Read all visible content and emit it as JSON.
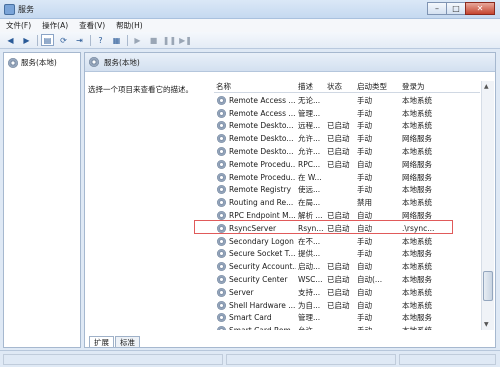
{
  "window": {
    "title": "服务"
  },
  "menu": [
    "文件(F)",
    "操作(A)",
    "查看(V)",
    "帮助(H)"
  ],
  "tree": {
    "root": "服务(本地)"
  },
  "pane": {
    "header": "服务(本地)",
    "description": "选择一个项目来查看它的描述。"
  },
  "columns": {
    "name": "名称",
    "desc": "描述",
    "status": "状态",
    "startup": "启动类型",
    "logon": "登录为"
  },
  "services": [
    {
      "name": "Remote Access ...",
      "desc": "无论...",
      "status": "",
      "startup": "手动",
      "logon": "本地系统"
    },
    {
      "name": "Remote Access ...",
      "desc": "管理...",
      "status": "",
      "startup": "手动",
      "logon": "本地系统"
    },
    {
      "name": "Remote Deskto...",
      "desc": "远程...",
      "status": "已启动",
      "startup": "手动",
      "logon": "本地系统"
    },
    {
      "name": "Remote Deskto...",
      "desc": "允许...",
      "status": "已启动",
      "startup": "手动",
      "logon": "网络服务"
    },
    {
      "name": "Remote Deskto...",
      "desc": "允许...",
      "status": "已启动",
      "startup": "手动",
      "logon": "本地系统"
    },
    {
      "name": "Remote Procedu...",
      "desc": "RPC...",
      "status": "已启动",
      "startup": "自动",
      "logon": "网络服务"
    },
    {
      "name": "Remote Procedu...",
      "desc": "在 W...",
      "status": "",
      "startup": "手动",
      "logon": "网络服务"
    },
    {
      "name": "Remote Registry",
      "desc": "使远...",
      "status": "",
      "startup": "手动",
      "logon": "本地服务"
    },
    {
      "name": "Routing and Re...",
      "desc": "在局...",
      "status": "",
      "startup": "禁用",
      "logon": "本地系统"
    },
    {
      "name": "RPC Endpoint M...",
      "desc": "解析 ...",
      "status": "已启动",
      "startup": "自动",
      "logon": "网络服务"
    },
    {
      "name": "RsyncServer",
      "desc": "Rsyn...",
      "status": "已启动",
      "startup": "自动",
      "logon": ".\\rsync..."
    },
    {
      "name": "Secondary Logon",
      "desc": "在不...",
      "status": "",
      "startup": "手动",
      "logon": "本地系统"
    },
    {
      "name": "Secure Socket T...",
      "desc": "提供...",
      "status": "",
      "startup": "手动",
      "logon": "本地服务"
    },
    {
      "name": "Security Account...",
      "desc": "启动...",
      "status": "已启动",
      "startup": "自动",
      "logon": "本地系统"
    },
    {
      "name": "Security Center",
      "desc": "WSC...",
      "status": "已启动",
      "startup": "自动(...",
      "logon": "本地服务"
    },
    {
      "name": "Server",
      "desc": "支持...",
      "status": "已启动",
      "startup": "自动",
      "logon": "本地系统"
    },
    {
      "name": "Shell Hardware ...",
      "desc": "为自...",
      "status": "已启动",
      "startup": "自动",
      "logon": "本地系统"
    },
    {
      "name": "Smart Card",
      "desc": "管理...",
      "status": "",
      "startup": "手动",
      "logon": "本地服务"
    },
    {
      "name": "Smart Card Rem...",
      "desc": "允许...",
      "status": "",
      "startup": "手动",
      "logon": "本地系统"
    }
  ],
  "tabs": [
    "扩展",
    "标准"
  ],
  "highlight_color": "#e05a5a"
}
